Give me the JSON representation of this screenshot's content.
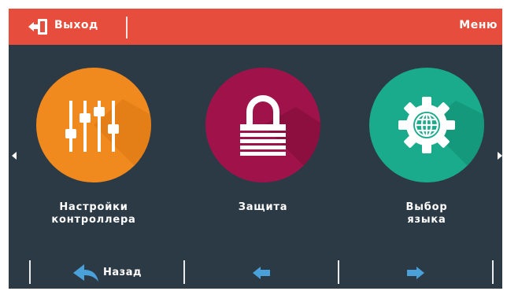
{
  "header": {
    "exit_label": "Выход",
    "title": "Меню"
  },
  "tiles": [
    {
      "label_line1": "Настройки",
      "label_line2": "контроллера",
      "color": "#f18a1e",
      "icon": "sliders-icon"
    },
    {
      "label_line1": "Защита",
      "label_line2": "",
      "color": "#a0134a",
      "icon": "lock-icon"
    },
    {
      "label_line1": "Выбор",
      "label_line2": "языка",
      "color": "#1aaa8c",
      "icon": "globe-gear-icon"
    }
  ],
  "footer": {
    "back_label": "Назад",
    "accent_color": "#4aa0d8"
  },
  "colors": {
    "topbar": "#e64d3c",
    "background": "#2c3a46"
  }
}
